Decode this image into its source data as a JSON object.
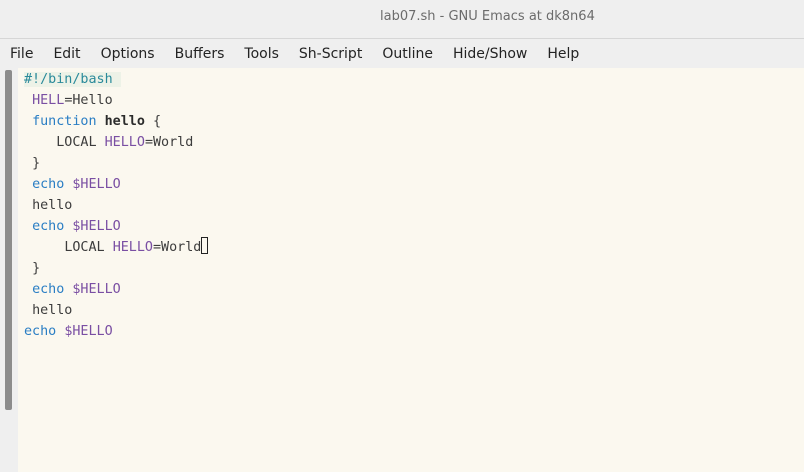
{
  "window": {
    "title": "lab07.sh - GNU Emacs at dk8n64"
  },
  "menubar": {
    "items": [
      "File",
      "Edit",
      "Options",
      "Buffers",
      "Tools",
      "Sh-Script",
      "Outline",
      "Hide/Show",
      "Help"
    ]
  },
  "editor": {
    "lines": [
      {
        "indent": "",
        "shebang": "#!/bin/bash"
      },
      {
        "indent": " ",
        "var": "HELL",
        "rest": "=Hello"
      },
      {
        "indent": " ",
        "kw": "function",
        "sp": " ",
        "fn": "hello",
        "rest": " {"
      },
      {
        "indent": "    ",
        "text": "LOCAL ",
        "var": "HELLO",
        "rest": "=World"
      },
      {
        "indent": " ",
        "text": "}"
      },
      {
        "indent": " ",
        "kw": "echo",
        "sp": " ",
        "var": "$HELLO"
      },
      {
        "indent": " ",
        "text": "hello"
      },
      {
        "indent": " ",
        "kw": "echo",
        "sp": " ",
        "var": "$HELLO"
      },
      {
        "indent": "     ",
        "text": "LOCAL ",
        "var": "HELLO",
        "rest": "=World",
        "cursor": true
      },
      {
        "indent": " ",
        "text": "}"
      },
      {
        "indent": " ",
        "kw": "echo",
        "sp": " ",
        "var": "$HELLO"
      },
      {
        "indent": " ",
        "text": "hello"
      },
      {
        "indent": "",
        "kw": "echo",
        "sp": " ",
        "var": "$HELLO"
      }
    ]
  },
  "colors": {
    "keyword": "#2a7ec4",
    "variable": "#7a4fa3",
    "shebang": "#2a8a9a",
    "editor_bg": "#fbf8ef"
  }
}
